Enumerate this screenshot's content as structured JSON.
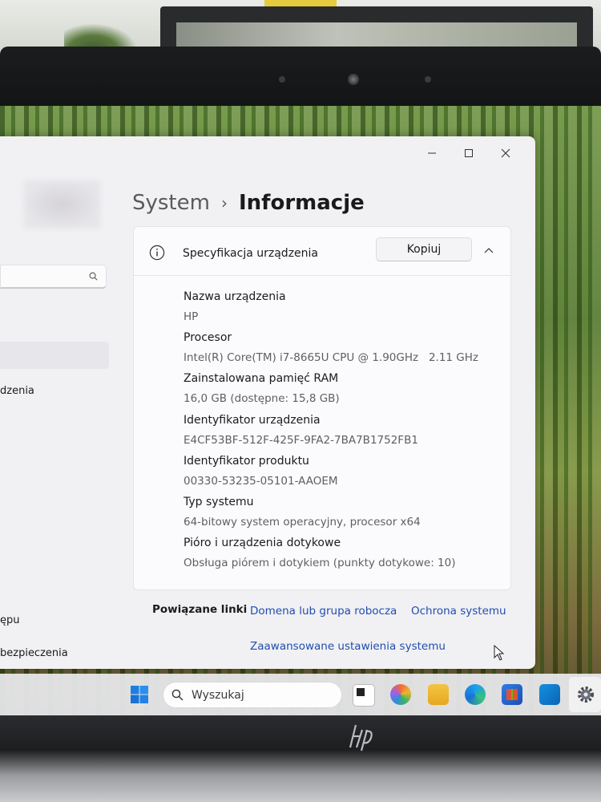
{
  "window": {
    "breadcrumb_root": "System",
    "breadcrumb_separator": "›",
    "page_title": "Informacje"
  },
  "sidebar": {
    "item_a": "dzenia",
    "item_b": "ępu",
    "item_c": "bezpieczenia"
  },
  "spec": {
    "title": "Specyfikacja urządzenia",
    "copy_label": "Kopiuj",
    "rows": [
      {
        "label": "Nazwa urządzenia",
        "value": "HP"
      },
      {
        "label": "Procesor",
        "value": "Intel(R) Core(TM) i7-8665U CPU @ 1.90GHz   2.11 GHz"
      },
      {
        "label": "Zainstalowana pamięć RAM",
        "value": "16,0 GB (dostępne: 15,8 GB)"
      },
      {
        "label": "Identyfikator urządzenia",
        "value": "E4CF53BF-512F-425F-9FA2-7BA7B1752FB1"
      },
      {
        "label": "Identyfikator produktu",
        "value": "00330-53235-05101-AAOEM"
      },
      {
        "label": "Typ systemu",
        "value": "64-bitowy system operacyjny, procesor x64"
      },
      {
        "label": "Pióro i urządzenia dotykowe",
        "value": "Obsługa piórem i dotykiem (punkty dotykowe: 10)"
      }
    ]
  },
  "related": {
    "title": "Powiązane linki",
    "link_domain": "Domena lub grupa robocza",
    "link_protection": "Ochrona systemu",
    "link_advanced": "Zaawansowane ustawienia systemu"
  },
  "taskbar": {
    "search_label": "Wyszukaj"
  },
  "colors": {
    "link": "#1f4fae",
    "window_bg": "#f1f0f3",
    "card_bg": "#fbfafc"
  }
}
